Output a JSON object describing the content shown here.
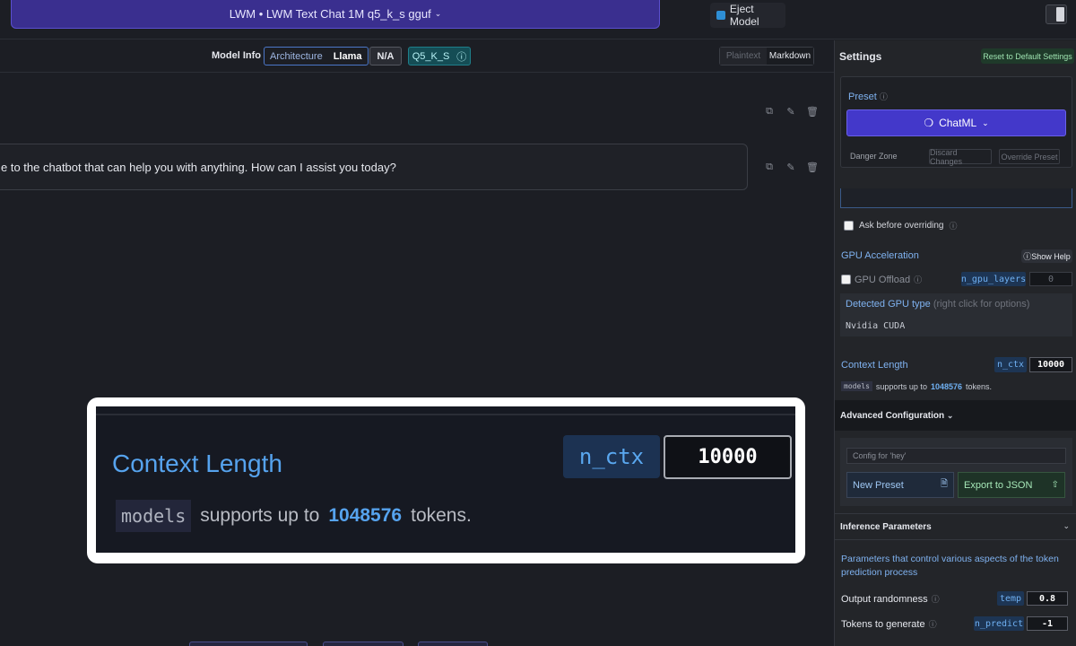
{
  "topbar": {
    "model_title": "LWM • LWM Text Chat 1M q5_k_s gguf",
    "eject_label": "Eject Model"
  },
  "model_info": {
    "label": "Model Info",
    "architecture_key": "Architecture",
    "architecture_value": "Llama",
    "na": "N/A",
    "quant": "Q5_K_S"
  },
  "format_toggle": {
    "plaintext": "Plaintext",
    "markdown": "Markdown"
  },
  "chat": {
    "assistant_message": "e to the chatbot that can help you with anything. How can I assist you today?"
  },
  "zoom": {
    "title": "Context Length",
    "param": "n_ctx",
    "value": "10000",
    "models": "models",
    "supports": "supports up to",
    "max": "1048576",
    "tokens": "tokens."
  },
  "settings": {
    "title": "Settings",
    "reset": "Reset to Default Settings",
    "preset_label": "Preset",
    "preset_value": "ChatML",
    "danger_zone": "Danger Zone",
    "discard": "Discard Changes",
    "override": "Override Preset",
    "ask_before": "Ask before overriding",
    "gpu_title": "GPU Acceleration",
    "show_help": "Show Help",
    "gpu_offload": "GPU Offload",
    "n_gpu_layers": "n_gpu_layers",
    "gpu_layers_value": "0",
    "detected_title": "Detected GPU type",
    "detected_hint": "(right click for options)",
    "detected_value": "Nvidia CUDA",
    "ctx_title": "Context Length",
    "ctx_param": "n_ctx",
    "ctx_value": "10000",
    "ctx_models": "models",
    "ctx_supports": "supports up to",
    "ctx_max": "1048576",
    "ctx_tokens": "tokens.",
    "advanced": "Advanced Configuration",
    "config_for": "Config for  'hey'",
    "new_preset": "New Preset",
    "export_json": "Export to JSON",
    "inference": "Inference Parameters",
    "inference_desc": "Parameters that control various aspects of the token prediction process",
    "output_randomness": "Output randomness",
    "temp": "temp",
    "temp_value": "0.8",
    "tokens_generate": "Tokens to generate",
    "n_predict": "n_predict",
    "n_predict_value": "-1"
  }
}
